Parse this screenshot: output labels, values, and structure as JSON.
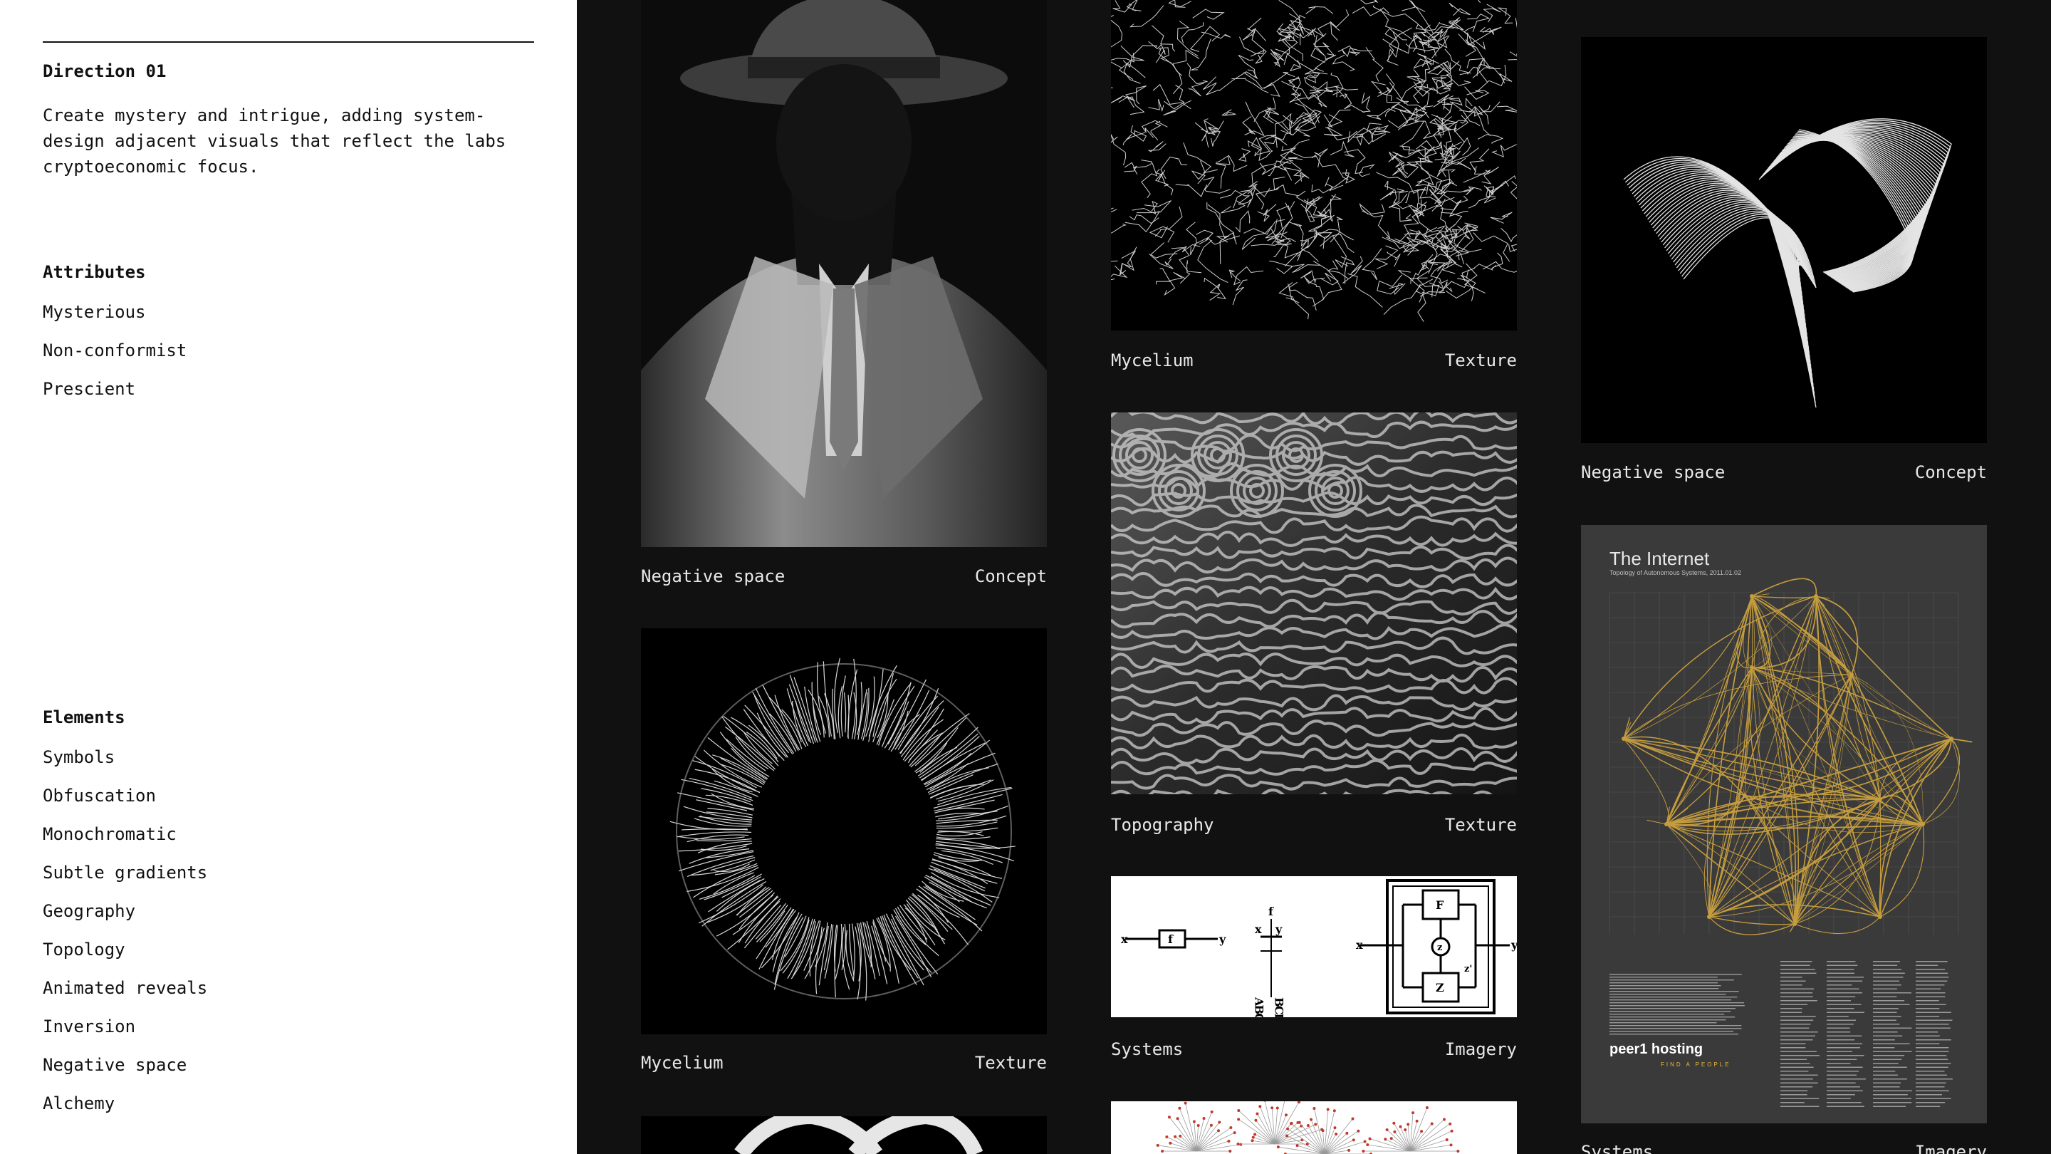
{
  "sidebar": {
    "title": "Direction 01",
    "description": "Create mystery and intrigue, adding system-\ndesign adjacent visuals that reflect the labs\ncryptoeconomic focus.",
    "attributes_heading": "Attributes",
    "attributes": [
      "Mysterious",
      "Non-conformist",
      "Prescient"
    ],
    "elements_heading": "Elements",
    "elements": [
      "Symbols",
      "Obfuscation",
      "Monochromatic",
      "Subtle gradients",
      "Geography",
      "Topology",
      "Animated reveals",
      "Inversion",
      "Negative space",
      "Alchemy"
    ]
  },
  "gallery": {
    "col1": [
      {
        "image": "man-in-hat-photo",
        "label": "Negative space",
        "category": "Concept"
      },
      {
        "image": "radial-mycelium-photo",
        "label": "Mycelium",
        "category": "Texture"
      },
      {
        "image": "white-knot-photo",
        "label": "",
        "category": ""
      }
    ],
    "col2": [
      {
        "image": "mycelium-network-photo",
        "label": "Mycelium",
        "category": "Texture"
      },
      {
        "image": "topography-relief-photo",
        "label": "Topography",
        "category": "Texture"
      },
      {
        "image": "systems-diagram-image",
        "label": "Systems",
        "category": "Imagery"
      },
      {
        "image": "tree-graph-image",
        "label": "",
        "category": ""
      }
    ],
    "col3": [
      {
        "image": "contour-shape-image",
        "label": "Negative space",
        "category": "Concept"
      },
      {
        "image": "internet-map-poster",
        "label": "Systems",
        "category": "Imagery"
      }
    ],
    "poster": {
      "title": "The Internet",
      "subtitle": "Topology of Autonomous Systems, 2011.01.02",
      "brand": "peer1 hosting",
      "brand_tag": "FIND A PEOPLE"
    },
    "diagram": {
      "f": "f",
      "x": "x",
      "y": "y",
      "F": "F",
      "z": "z",
      "Z": "Z",
      "zprime": "z'",
      "col_a": "ABCD",
      "col_b": "BCDA"
    }
  },
  "colors": {
    "sidebar_bg": "#ffffff",
    "gallery_bg": "#111111",
    "accent_gold": "#e8b640",
    "poster_bg": "#3a3a3a"
  }
}
